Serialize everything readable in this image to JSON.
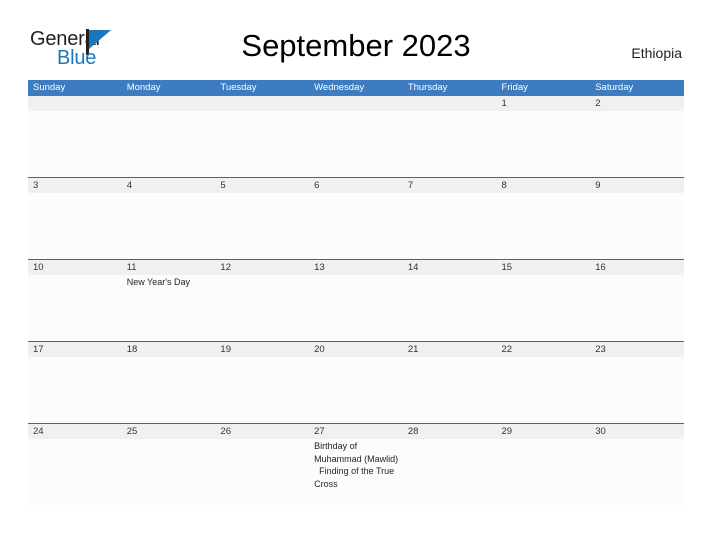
{
  "brand": {
    "word_general": "General",
    "word_blue": "Blue",
    "flag_icon": "flag-icon"
  },
  "header": {
    "title": "September 2023",
    "locale": "Ethiopia"
  },
  "colors": {
    "header_blue": "#3d7cc0",
    "separator_blue": "#2e6da4",
    "brand_blue": "#1b75bb",
    "date_band_gray": "#f0f0f0",
    "cell_background": "#fcfcfc",
    "text": "#231f20"
  },
  "calendar": {
    "month": "September",
    "year": "2023",
    "weekdays": [
      "Sunday",
      "Monday",
      "Tuesday",
      "Wednesday",
      "Thursday",
      "Friday",
      "Saturday"
    ],
    "weeks": [
      {
        "dates": [
          "",
          "",
          "",
          "",
          "",
          "1",
          "2"
        ],
        "events": [
          [],
          [],
          [],
          [],
          [],
          [],
          []
        ]
      },
      {
        "dates": [
          "3",
          "4",
          "5",
          "6",
          "7",
          "8",
          "9"
        ],
        "events": [
          [],
          [],
          [],
          [],
          [],
          [],
          []
        ]
      },
      {
        "dates": [
          "10",
          "11",
          "12",
          "13",
          "14",
          "15",
          "16"
        ],
        "events": [
          [],
          [
            "New Year's Day"
          ],
          [],
          [],
          [],
          [],
          []
        ]
      },
      {
        "dates": [
          "17",
          "18",
          "19",
          "20",
          "21",
          "22",
          "23"
        ],
        "events": [
          [],
          [],
          [],
          [],
          [],
          [],
          []
        ]
      },
      {
        "dates": [
          "24",
          "25",
          "26",
          "27",
          "28",
          "29",
          "30"
        ],
        "events": [
          [],
          [],
          [],
          [
            "Birthday of Muhammad (Mawlid)",
            "Finding of the True Cross"
          ],
          [],
          [],
          []
        ]
      }
    ]
  }
}
